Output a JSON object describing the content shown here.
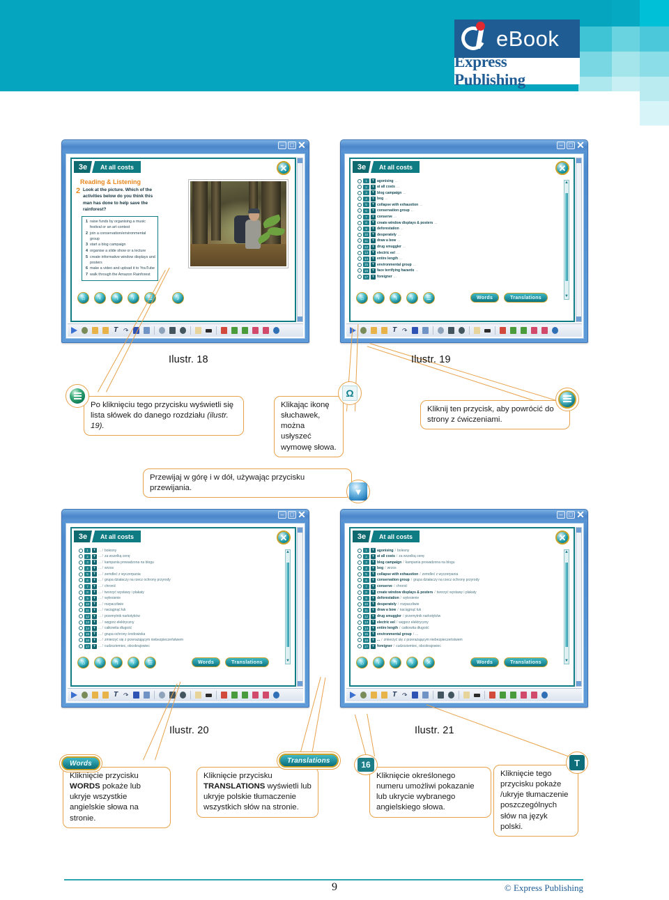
{
  "header": {
    "logo_primary": "eBook",
    "logo_secondary": "Express Publishing",
    "brand_teal": "#05A5C0",
    "logo_blue": "#1F5C94",
    "logo_dot_red": "#E0282E"
  },
  "figures": {
    "fig18": "Ilustr. 18",
    "fig19": "Ilustr. 19",
    "fig20": "Ilustr. 20",
    "fig21": "Ilustr. 21"
  },
  "callouts": {
    "words_list_button": "Po kliknięciu tego przycisku wyświetli się lista słówek do danego rozdziału (ilustr. 19).",
    "words_list_button_plain": "Po kliknięciu tego przycisku wyświetli się",
    "words_list_button_italic_line": "lista słówek do danego rozdziału ",
    "words_list_button_italic": "(ilustr. 19).",
    "headphones": "Klikając ikonę słuchawek, można usłyszeć wymowę słowa.",
    "return_button": "Kliknij ten przycisk, aby powrócić do strony z ćwiczeniami.",
    "scroll": "Przewijaj w górę i w dół, używając przycisku przewijania.",
    "words_button_pre": "Kliknięcie",
    "words_button_mid": "przycisku ",
    "words_button_bold": "WORDS",
    "words_button_post": " pokaże lub ukryje wszystkie angielskie słowa na stronie.",
    "translations_pre": "Kliknięcie przycisku ",
    "translations_bold": "TRANSLATIONS",
    "translations_post": " wyświetli lub ukryje polskie tłumaczenie wszystkich słów na stronie.",
    "number_button": "Kliknięcie określonego numeru umożliwi pokazanie lub ukrycie wybranego angielskiego słowa.",
    "t_button": "Kliknięcie tego przycisku pokaże /ukryje tłumaczenie poszczególnych słów na język polski."
  },
  "icons": {
    "words_list": "list-icon",
    "headphones": "headphones-icon",
    "return": "return-to-exercises-icon",
    "scroll_down": "scroll-down-icon",
    "words_btn": "Words",
    "translations_btn": "Translations",
    "number_badge": "16",
    "t_badge": "T"
  },
  "screenshots": {
    "fig18": {
      "chapter_num": "3e",
      "chapter_title": "At all costs",
      "section_heading": "Reading & Listening",
      "exercise_number": "2",
      "question": "Look at the picture. Which of the activities below do you think this man has done to help save the rainforest?",
      "options": [
        {
          "n": "1",
          "text": "raise funds by organising a music festival or an art contest"
        },
        {
          "n": "2",
          "text": "join a conservation/environmental group"
        },
        {
          "n": "3",
          "text": "start a blog campaign"
        },
        {
          "n": "4",
          "text": "organise a slide show or a lecture"
        },
        {
          "n": "5",
          "text": "create informative window displays and posters"
        },
        {
          "n": "6",
          "text": "make a video and upload it to YouTube"
        },
        {
          "n": "7",
          "text": "walk through the Amazon Rainforest"
        }
      ]
    },
    "fig19": {
      "chapter_num": "3e",
      "chapter_title": "At all costs",
      "words": [
        {
          "n": "1",
          "en": "agonising"
        },
        {
          "n": "2",
          "en": "at all costs"
        },
        {
          "n": "3",
          "en": "blog campaign"
        },
        {
          "n": "4",
          "en": "bog"
        },
        {
          "n": "5",
          "en": "collapse with exhaustion"
        },
        {
          "n": "6",
          "en": "conservation group"
        },
        {
          "n": "7",
          "en": "conserve"
        },
        {
          "n": "8",
          "en": "create window displays & posters"
        },
        {
          "n": "9",
          "en": "deforestation"
        },
        {
          "n": "10",
          "en": "desperately"
        },
        {
          "n": "11",
          "en": "draw a bow"
        },
        {
          "n": "12",
          "en": "drug smuggler"
        },
        {
          "n": "13",
          "en": "electric eel"
        },
        {
          "n": "14",
          "en": "entire length"
        },
        {
          "n": "15",
          "en": "environmental group"
        },
        {
          "n": "16",
          "en": "face terrifying hazards"
        },
        {
          "n": "17",
          "en": "foreigner"
        }
      ],
      "buttons": {
        "words": "Words",
        "translations": "Translations"
      }
    },
    "fig20": {
      "chapter_num": "3e",
      "chapter_title": "At all costs",
      "words": [
        {
          "n": "1",
          "pl": "bolesny"
        },
        {
          "n": "2",
          "pl": "za wszelką cenę"
        },
        {
          "n": "3",
          "pl": "kampania prowadzona na blogu"
        },
        {
          "n": "4",
          "pl": "wrzos"
        },
        {
          "n": "5",
          "pl": "zemdleć z wyczerpania"
        },
        {
          "n": "6",
          "pl": "grupa działaczy na rzecz ochrony przyrody"
        },
        {
          "n": "7",
          "pl": "chronić"
        },
        {
          "n": "8",
          "pl": "tworzyć wystawy i plakaty"
        },
        {
          "n": "9",
          "pl": "wylesienie"
        },
        {
          "n": "10",
          "pl": "rozpaczliwie"
        },
        {
          "n": "11",
          "pl": "naciągnąć łuk"
        },
        {
          "n": "12",
          "pl": "przemytnik narkotyków"
        },
        {
          "n": "13",
          "pl": "węgorz elektryczny"
        },
        {
          "n": "14",
          "pl": "całkowita długość"
        },
        {
          "n": "15",
          "pl": "grupa ochrony środowiska"
        },
        {
          "n": "16",
          "pl": "zmierzyć się z przerażającym niebezpieczeństwem"
        },
        {
          "n": "17",
          "pl": "cudzoziemiec, obcokrajowiec"
        }
      ],
      "buttons": {
        "words": "Words",
        "translations": "Translations"
      }
    },
    "fig21": {
      "chapter_num": "3e",
      "chapter_title": "At all costs",
      "words": [
        {
          "n": "1",
          "en": "agonising",
          "pl": "bolesny"
        },
        {
          "n": "2",
          "en": "at all costs",
          "pl": "za wszelką cenę"
        },
        {
          "n": "3",
          "en": "blog campaign",
          "pl": "kampania prowadzona na blogu"
        },
        {
          "n": "4",
          "en": "bog",
          "pl": "wrzos"
        },
        {
          "n": "5",
          "en": "collapse with exhaustion",
          "pl": "zemdleć z wyczerpania"
        },
        {
          "n": "6",
          "en": "conservation group",
          "pl": "grupa działaczy na rzecz ochrony przyrody"
        },
        {
          "n": "7",
          "en": "conserve",
          "pl": "chronić"
        },
        {
          "n": "8",
          "en": "create window displays & posters",
          "pl": "tworzyć wystawy i plakaty"
        },
        {
          "n": "9",
          "en": "deforestation",
          "pl": "wylesienie"
        },
        {
          "n": "10",
          "en": "desperately",
          "pl": "rozpaczliwie"
        },
        {
          "n": "11",
          "en": "draw a bow",
          "pl": "naciągnąć łuk"
        },
        {
          "n": "12",
          "en": "drug smuggler",
          "pl": "przemytnik narkotyków"
        },
        {
          "n": "13",
          "en": "electric eel",
          "pl": "węgorz elektryczny"
        },
        {
          "n": "14",
          "en": "entire length",
          "pl": "całkowita długość"
        },
        {
          "n": "15",
          "en": "environmental group",
          "pl": ""
        },
        {
          "n": "16",
          "en": "",
          "pl": "zmierzyć się z przerażającym niebezpieczeństwem"
        },
        {
          "n": "17",
          "en": "foreigner",
          "pl": "cudzoziemiec, obcokrajowiec"
        }
      ],
      "buttons": {
        "words": "Words",
        "translations": "Translations"
      }
    }
  },
  "footer": {
    "page_number": "9",
    "copyright": "© Express Publishing",
    "rule_color": "#2BA5AE"
  }
}
